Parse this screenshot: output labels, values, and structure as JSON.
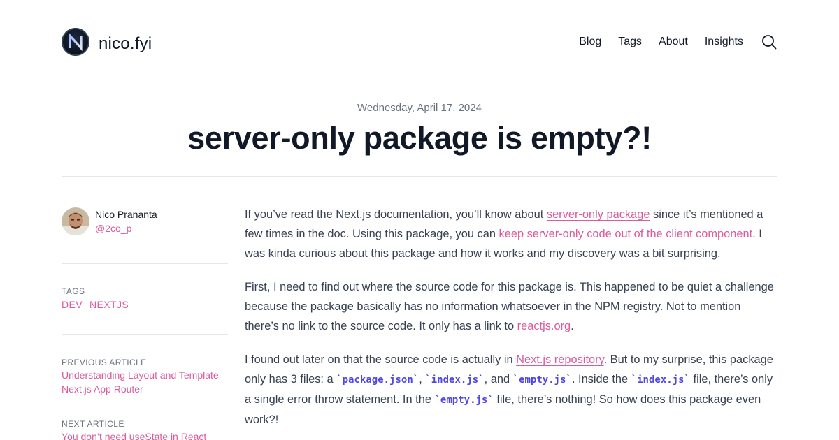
{
  "header": {
    "site_name": "nico.fyi",
    "nav": [
      "Blog",
      "Tags",
      "About",
      "Insights"
    ]
  },
  "post": {
    "date": "Wednesday, April 17, 2024",
    "title": "server-only package is empty?!"
  },
  "sidebar": {
    "author_name": "Nico Prananta",
    "author_handle": "@2co_p",
    "tags_label": "TAGS",
    "tags": [
      "DEV",
      "NEXTJS"
    ],
    "previous_label": "PREVIOUS ARTICLE",
    "previous_title": "Understanding Layout and Template Next.js App Router",
    "next_label": "NEXT ARTICLE",
    "next_title": "You don’t need useState in React"
  },
  "article": {
    "p1": {
      "t1": "If you’ve read the Next.js documentation, you’ll know about ",
      "link1": "server-only package",
      "t2": " since it’s mentioned a few times in the doc. Using this package, you can ",
      "link2": "keep server-only code out of the client component",
      "t3": ". I was kinda curious about this package and how it works and my discovery was a bit surprising."
    },
    "p2": {
      "t1": "First, I need to find out where the source code for this package is. This happened to be quiet a challenge because the package basically has no information whatsoever in the NPM registry. Not to mention there’s no link to the source code. It only has a link to ",
      "link1": "reactjs.org",
      "t2": "."
    },
    "p3": {
      "t1": "I found out later on that the source code is actually in ",
      "link1": "Next.js repository",
      "t2": ". But to my surprise, this package only has 3 files: a ",
      "code1": "`package.json`",
      "t3": ", ",
      "code2": "`index.js`",
      "t4": ", and ",
      "code3": "`empty.js`",
      "t5": ". Inside the ",
      "code4": "`index.js`",
      "t6": " file, there’s only a single error throw statement. In the ",
      "code5": "`empty.js`",
      "t7": " file, there’s nothing! So how does this package even work?!"
    }
  },
  "colors": {
    "accent": "#db5b9c",
    "code": "#4f46e5",
    "text": "#374151",
    "heading": "#111827"
  },
  "icons": [
    "logo-icon",
    "search-icon",
    "avatar"
  ]
}
